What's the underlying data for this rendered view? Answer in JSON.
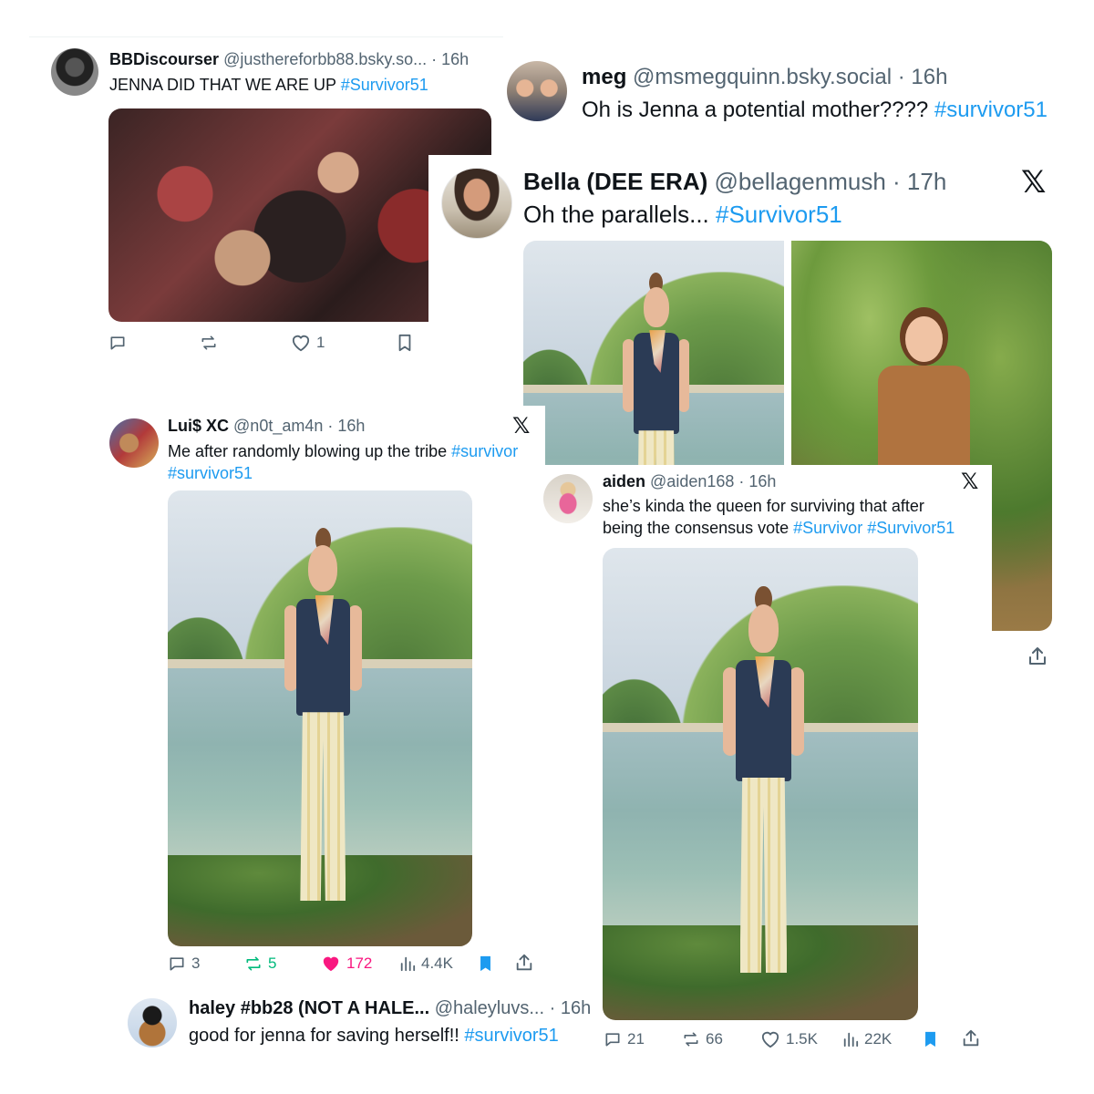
{
  "tweet1": {
    "name": "BBDiscourser",
    "handle": "@justhereforbb88.bsky.so...",
    "time": "· 16h",
    "text": "JENNA DID THAT WE ARE UP ",
    "hashtag": "#Survivor51",
    "like_count": "1",
    "icons": [
      "reply-icon",
      "repost-icon",
      "heart-icon",
      "bookmark-icon"
    ]
  },
  "tweet2": {
    "name": "meg",
    "handle": "@msmegquinn.bsky.social",
    "time": "· 16h",
    "text": "Oh is Jenna a potential mother???? ",
    "hashtag": "#survivor51"
  },
  "tweet3": {
    "name": "Bella (DEE ERA)",
    "handle": "@bellagenmush",
    "time": "· 17h",
    "text": "Oh the parallels... ",
    "hashtag": "#Survivor51",
    "x_logo": "𝕏"
  },
  "tweet4": {
    "name": "Lui$ XC",
    "handle": "@n0t_am4n",
    "time": "· 16h",
    "text": "Me after randomly blowing up the tribe ",
    "hashtag1": "#survivor",
    "hashtag2": "#survivor51",
    "x_logo": "𝕏",
    "stats": {
      "replies": "3",
      "reposts": "5",
      "likes": "172",
      "views": "4.4K"
    },
    "colors": {
      "repost": "#00ba7c",
      "like": "#f91880",
      "bookmark": "#1d9bf0"
    }
  },
  "tweet5": {
    "name": "aiden",
    "handle": "@aiden168",
    "time": "· 16h",
    "text_line1": "she’s kinda the queen for surviving that after",
    "text_line2": "being the consensus vote ",
    "hashtag1": "#Survivor",
    "hashtag2": "#Survivor51",
    "x_logo": "𝕏",
    "stats": {
      "replies": "21",
      "reposts": "66",
      "likes": "1.5K",
      "views": "22K"
    }
  },
  "tweet6": {
    "name": "haley #bb28 (NOT A HALE...",
    "handle": "@haleyluvs...",
    "time": "· 16h",
    "text": "good for jenna for saving herself!! ",
    "hashtag": "#survivor51"
  }
}
